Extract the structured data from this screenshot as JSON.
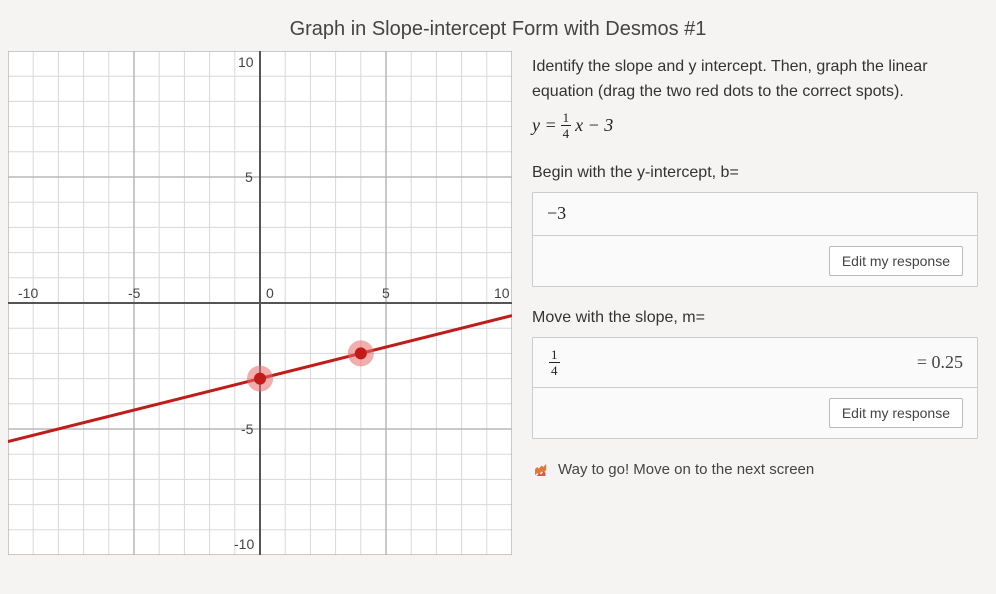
{
  "title": "Graph in Slope-intercept Form with Desmos #1",
  "instructions": "Identify the slope and y intercept. Then, graph the linear equation (drag the two red dots to the correct spots).",
  "equation": {
    "prefix": "y =",
    "frac_num": "1",
    "frac_den": "4",
    "suffix": "x − 3"
  },
  "q1": {
    "prompt": "Begin with the y-intercept, b=",
    "answer": "−3",
    "edit_label": "Edit my response"
  },
  "q2": {
    "prompt": "Move with the slope, m=",
    "answer_num": "1",
    "answer_den": "4",
    "computed": "= 0.25",
    "edit_label": "Edit my response"
  },
  "success_msg": "Way to go! Move on to the next screen",
  "chart_data": {
    "type": "line",
    "xlim": [
      -10,
      10
    ],
    "ylim": [
      -10,
      10
    ],
    "x_ticks": [
      -10,
      -5,
      0,
      5,
      10
    ],
    "y_ticks": [
      -10,
      -5,
      0,
      5,
      10
    ],
    "line": {
      "slope": 0.25,
      "intercept": -3
    },
    "points": [
      {
        "x": 0,
        "y": -3
      },
      {
        "x": 4,
        "y": -2
      }
    ]
  }
}
